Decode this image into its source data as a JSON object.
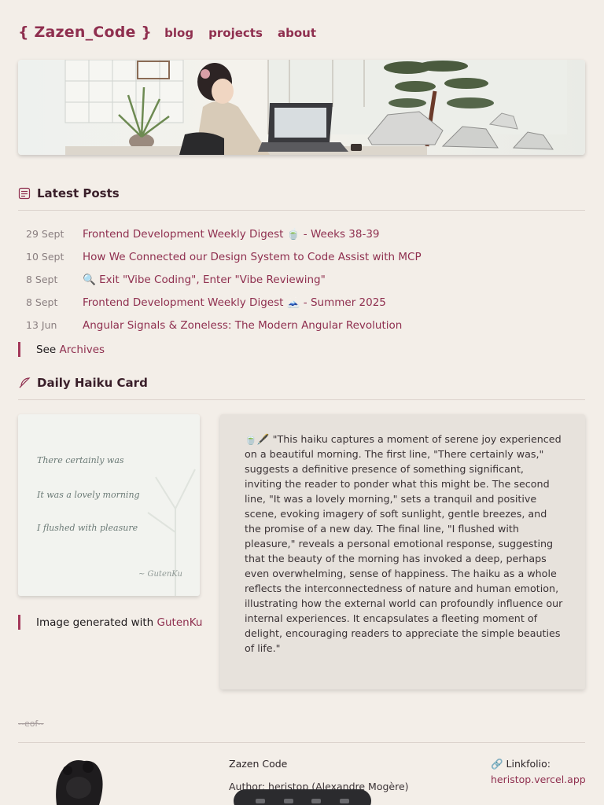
{
  "site": {
    "logo": "{ Zazen_Code }",
    "nav": [
      "blog",
      "projects",
      "about"
    ]
  },
  "latest_posts": {
    "heading": "Latest Posts",
    "icon": "document-icon",
    "items": [
      {
        "date": "29 Sept",
        "title": "Frontend Development Weekly Digest 🍵 - Weeks 38-39"
      },
      {
        "date": "10 Sept",
        "title": "How We Connected our Design System to Code Assist with MCP"
      },
      {
        "date": "8 Sept",
        "title": "🔍 Exit \"Vibe Coding\", Enter \"Vibe Reviewing\""
      },
      {
        "date": "8 Sept",
        "title": "Frontend Development Weekly Digest 🗻 - Summer 2025"
      },
      {
        "date": "13 Jun",
        "title": "Angular Signals & Zoneless: The Modern Angular Revolution"
      }
    ],
    "archives_prefix": "See",
    "archives_link": "Archives"
  },
  "haiku": {
    "heading": "Daily Haiku Card",
    "icon": "feather-icon",
    "lines": [
      "There certainly was",
      "It was a lovely morning",
      "I flushed with pleasure"
    ],
    "signature": "~ GutenKu",
    "credit_prefix": "Image generated with",
    "credit_link": "GutenKu",
    "explanation": "🍵🖋️ \"This haiku captures a moment of serene joy experienced on a beautiful morning. The first line, \"There certainly was,\" suggests a definitive presence of something significant, inviting the reader to ponder what this might be. The second line, \"It was a lovely morning,\" sets a tranquil and positive scene, evoking imagery of soft sunlight, gentle breezes, and the promise of a new day. The final line, \"I flushed with pleasure,\" reveals a personal emotional response, suggesting that the beauty of the morning has invoked a deep, perhaps even overwhelming, sense of happiness. The haiku as a whole reflects the interconnectedness of nature and human emotion, illustrating how the external world can profoundly influence our internal experiences. It encapsulates a fleeting moment of delight, encouraging readers to appreciate the simple beauties of life.\""
  },
  "footer": {
    "eof": "--eof--",
    "name": "Zazen Code",
    "author": "Author: heristop (Alexandre Mogère)",
    "linkfolio_label": "🔗 Linkfolio:",
    "linkfolio_url": "heristop.vercel.app"
  },
  "colors": {
    "accent": "#8f2f4f",
    "background": "#f3eee8",
    "card": "#e7e2dc"
  }
}
